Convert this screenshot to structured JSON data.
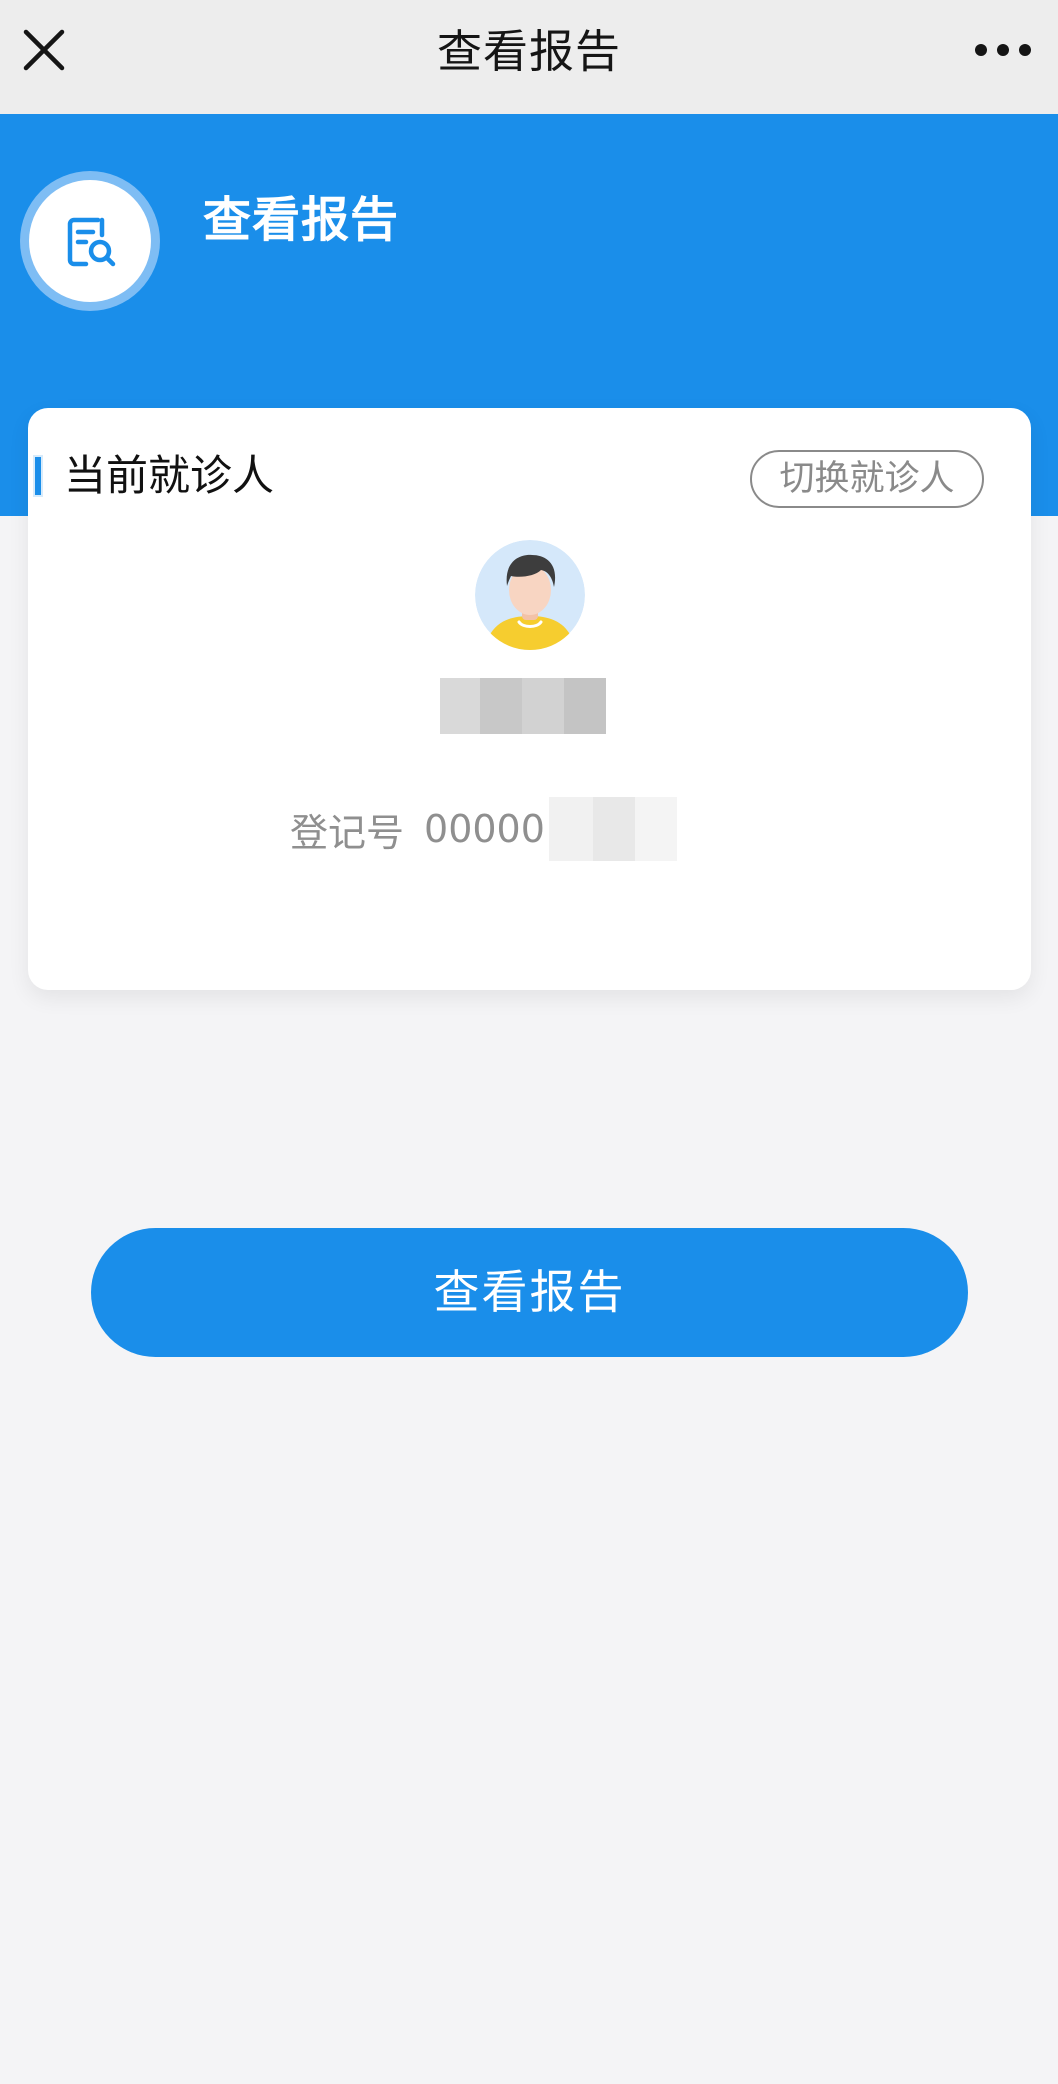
{
  "nav": {
    "title": "查看报告",
    "close_icon": "close-icon",
    "more_icon": "more-icon"
  },
  "header": {
    "title": "查看报告",
    "icon": "report-search-icon"
  },
  "patient": {
    "section_title": "当前就诊人",
    "switch_label": "切换就诊人",
    "avatar_icon": "avatar-icon",
    "registration_label": "登记号",
    "registration_value": "00000"
  },
  "action": {
    "view_report_label": "查看报告"
  },
  "colors": {
    "primary": "#1a8eea",
    "background": "#f4f4f6",
    "nav_background": "#ededed"
  }
}
